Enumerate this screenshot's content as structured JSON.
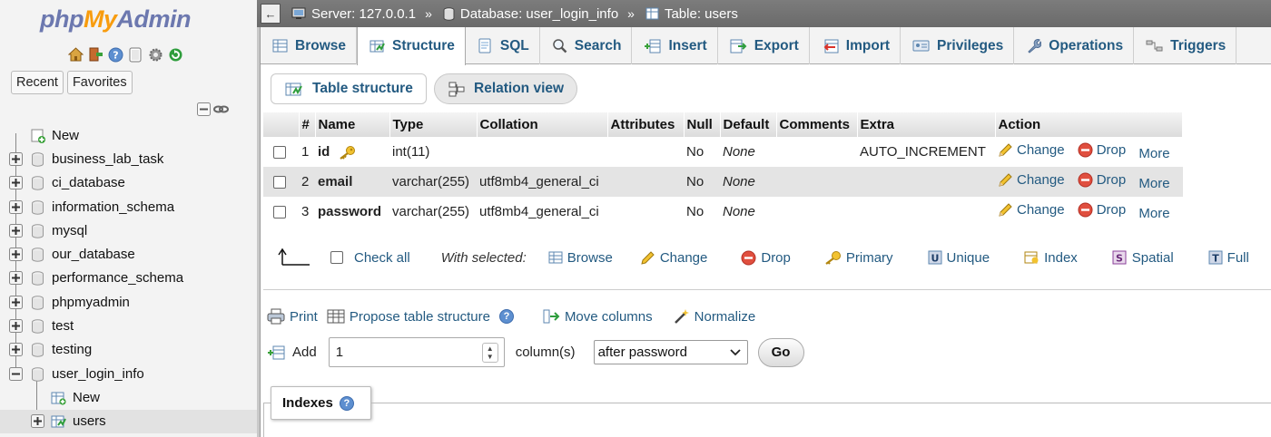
{
  "sidebar": {
    "logo": {
      "php": "php",
      "my": "My",
      "admin": "Admin"
    },
    "quick_icons": [
      "home-icon",
      "logout-icon",
      "help-icon",
      "docs-icon",
      "settings-icon",
      "reload-icon"
    ],
    "tabs": {
      "recent": "Recent",
      "favorites": "Favorites"
    },
    "tree": [
      {
        "label": "New",
        "icon": "new-icon"
      },
      {
        "label": "business_lab_task",
        "icon": "database-icon"
      },
      {
        "label": "ci_database",
        "icon": "database-icon"
      },
      {
        "label": "information_schema",
        "icon": "database-icon"
      },
      {
        "label": "mysql",
        "icon": "database-icon"
      },
      {
        "label": "our_database",
        "icon": "database-icon"
      },
      {
        "label": "performance_schema",
        "icon": "database-icon"
      },
      {
        "label": "phpmyadmin",
        "icon": "database-icon"
      },
      {
        "label": "test",
        "icon": "database-icon"
      },
      {
        "label": "testing",
        "icon": "database-icon"
      },
      {
        "label": "user_login_info",
        "icon": "database-icon"
      },
      {
        "label": "New",
        "icon": "new-table-icon"
      },
      {
        "label": "users",
        "icon": "table-icon"
      }
    ]
  },
  "breadcrumb": {
    "server": "Server: 127.0.0.1",
    "database": "Database: user_login_info",
    "table": "Table: users",
    "separator": "»"
  },
  "tabs": [
    "Browse",
    "Structure",
    "SQL",
    "Search",
    "Insert",
    "Export",
    "Import",
    "Privileges",
    "Operations",
    "Triggers"
  ],
  "active_tab": "Structure",
  "subtabs": {
    "table_structure": "Table structure",
    "relation_view": "Relation view"
  },
  "table": {
    "headers": [
      "#",
      "Name",
      "Type",
      "Collation",
      "Attributes",
      "Null",
      "Default",
      "Comments",
      "Extra",
      "Action"
    ],
    "rows": [
      {
        "num": "1",
        "name": "id",
        "type": "int(11)",
        "collation": "",
        "attributes": "",
        "null": "No",
        "default": "None",
        "comments": "",
        "extra": "AUTO_INCREMENT"
      },
      {
        "num": "2",
        "name": "email",
        "type": "varchar(255)",
        "collation": "utf8mb4_general_ci",
        "attributes": "",
        "null": "No",
        "default": "None",
        "comments": "",
        "extra": ""
      },
      {
        "num": "3",
        "name": "password",
        "type": "varchar(255)",
        "collation": "utf8mb4_general_ci",
        "attributes": "",
        "null": "No",
        "default": "None",
        "comments": "",
        "extra": ""
      }
    ],
    "actions": {
      "change": "Change",
      "drop": "Drop",
      "more": "More"
    }
  },
  "with_selected": {
    "check_all": "Check all",
    "label": "With selected:",
    "browse": "Browse",
    "change": "Change",
    "drop": "Drop",
    "primary": "Primary",
    "unique": "Unique",
    "index": "Index",
    "spatial": "Spatial",
    "fulltext": "Full"
  },
  "bottom": {
    "print": "Print",
    "propose": "Propose table structure",
    "move_columns": "Move columns",
    "normalize": "Normalize",
    "add": "Add",
    "add_count": "1",
    "columns_label": "column(s)",
    "position_select": "after password",
    "go": "Go"
  },
  "indexes": {
    "title": "Indexes"
  },
  "colors": {
    "link": "#235a81",
    "breadcrumb_bg": "#707070",
    "logo_blue": "#6c78af",
    "logo_orange": "#f89c0e",
    "drop_red": "#e04f3f"
  }
}
